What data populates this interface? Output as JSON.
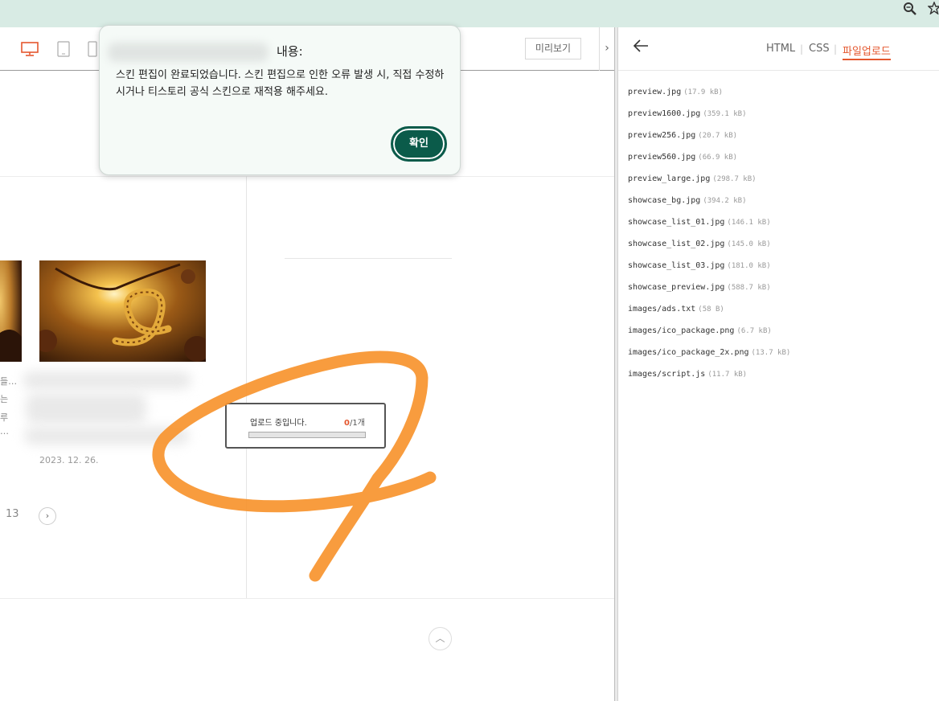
{
  "browser": {
    "icons": [
      "zoom-icon",
      "bookmark-star-icon"
    ],
    "background": "#d8ebe4"
  },
  "editor": {
    "devices": [
      "desktop-icon",
      "tablet-icon",
      "mobile-icon"
    ],
    "preview_label": "미리보기",
    "collapse_glyph": "›",
    "post": {
      "date": "2023. 12. 26.",
      "fragments": [
        "들…",
        "는",
        "루",
        "…"
      ]
    },
    "pagination": {
      "page": "13",
      "next_glyph": "›"
    },
    "top_glyph": "︿"
  },
  "dialog": {
    "title_suffix": "내용:",
    "message": "스킨 편집이 완료되었습니다. 스킨 편집으로 인한 오류 발생 시, 직접 수정하시거나 티스토리 공식 스킨으로 재적용 해주세요.",
    "ok_label": "확인"
  },
  "upload": {
    "label": "업로드 중입니다.",
    "done": "0",
    "total": "/1개",
    "progress": 0
  },
  "panel": {
    "tabs": [
      {
        "label": "HTML",
        "active": false
      },
      {
        "label": "CSS",
        "active": false
      },
      {
        "label": "파일업로드",
        "active": true
      }
    ],
    "files": [
      {
        "name": "preview.jpg",
        "size": "(17.9 kB)"
      },
      {
        "name": "preview1600.jpg",
        "size": "(359.1 kB)"
      },
      {
        "name": "preview256.jpg",
        "size": "(20.7 kB)"
      },
      {
        "name": "preview560.jpg",
        "size": "(66.9 kB)"
      },
      {
        "name": "preview_large.jpg",
        "size": "(298.7 kB)"
      },
      {
        "name": "showcase_bg.jpg",
        "size": "(394.2 kB)"
      },
      {
        "name": "showcase_list_01.jpg",
        "size": "(146.1 kB)"
      },
      {
        "name": "showcase_list_02.jpg",
        "size": "(145.0 kB)"
      },
      {
        "name": "showcase_list_03.jpg",
        "size": "(181.0 kB)"
      },
      {
        "name": "showcase_preview.jpg",
        "size": "(588.7 kB)"
      },
      {
        "name": "images/ads.txt",
        "size": "(58 B)"
      },
      {
        "name": "images/ico_package.png",
        "size": "(6.7 kB)"
      },
      {
        "name": "images/ico_package_2x.png",
        "size": "(13.7 kB)"
      },
      {
        "name": "images/script.js",
        "size": "(11.7 kB)"
      }
    ]
  },
  "colors": {
    "accent": "#e4572e",
    "ok_button": "#0b5b4a",
    "annotation": "#f7942e"
  }
}
